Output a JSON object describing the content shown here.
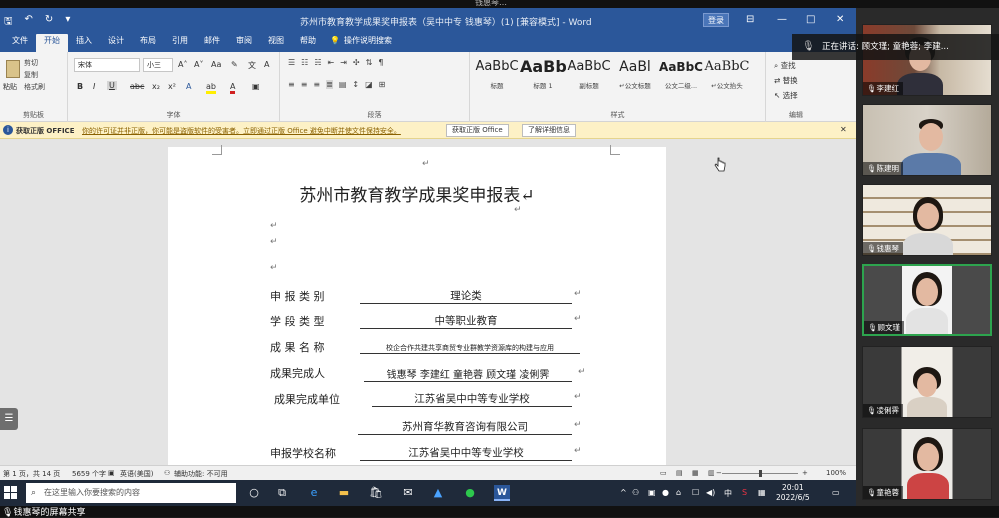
{
  "topbar": {
    "text": "钱惠琴…"
  },
  "window": {
    "title": "苏州市教育教学成果奖申报表（吴中中专 钱惠琴）(1) [兼容模式] - Word",
    "login_label": "登录",
    "controls": [
      "⊟",
      "—",
      "□",
      "✕"
    ]
  },
  "ribbon_tabs": [
    "文件",
    "开始",
    "插入",
    "设计",
    "布局",
    "引用",
    "邮件",
    "审阅",
    "视图",
    "帮助"
  ],
  "ribbon_search": "操作说明搜索",
  "clipboard": {
    "paste": "粘贴",
    "cut": "剪切",
    "copy": "复制",
    "format_painter": "格式刷",
    "label": "剪贴板"
  },
  "font_group": {
    "font_name": "宋体",
    "font_size": "小三",
    "label": "字体",
    "buttons": [
      "B",
      "I",
      "U",
      "abc",
      "x₂",
      "x²"
    ]
  },
  "paragraph_group": {
    "label": "段落"
  },
  "styles_group": {
    "label": "样式",
    "items": [
      {
        "sample": "AaBbC",
        "name": "标题"
      },
      {
        "sample": "AaBb",
        "name": "标题 1"
      },
      {
        "sample": "AaBbC",
        "name": "副标题"
      },
      {
        "sample": "AaBl",
        "name": "↵公文标题"
      },
      {
        "sample": "AaBbC",
        "name": "公文二级..."
      },
      {
        "sample": "AaBbC",
        "name": "↵公文抬头"
      }
    ]
  },
  "editing_group": {
    "find": "查找",
    "replace": "替换",
    "select": "选择",
    "label": "编辑"
  },
  "infobar": {
    "title": "获取正版 OFFICE",
    "message": "你的许可证并非正版，你可能是盗版软件的受害者。立即通过正版 Office 避免中断并使文件保持安全。",
    "btn_genuine": "获取正版 Office",
    "btn_learn": "了解详细信息"
  },
  "document": {
    "title": "苏州市教育教学成果奖申报表↵",
    "rows": [
      {
        "label": "申 报 类 别",
        "value": "理论类"
      },
      {
        "label": "学 段 类 型",
        "value": "中等职业教育"
      },
      {
        "label": "成 果 名 称",
        "value": "校企合作共建共享商贸专业群教学资源库的构建与应用"
      },
      {
        "label": "成果完成人",
        "value": "钱惠琴  李建红  童艳蓉  顾文瑾  凌俐霁"
      },
      {
        "label": "成果完成单位",
        "value": "江苏省吴中中等专业学校"
      },
      {
        "label": "",
        "value": "苏州育华教育咨询有限公司"
      },
      {
        "label": "申报学校名称",
        "value": "江苏省吴中中等专业学校"
      }
    ]
  },
  "status": {
    "page": "第 1 页，共 14 页",
    "words": "5659 个字",
    "lang": "英语(美国)",
    "accessibility": "辅助功能: 不可用",
    "zoom": "100%"
  },
  "taskbar": {
    "search_placeholder": "在这里输入你要搜索的内容",
    "time": "20:01",
    "date": "2022/6/5",
    "tray_lang": "中"
  },
  "share": {
    "text": "钱惠琴的屏幕共享"
  },
  "meeting": {
    "speaking": "正在讲话: 顾文瑾; 童艳蓉; 李建...",
    "participants": [
      "李建红",
      "陈建明",
      "钱惠琴",
      "顾文瑾",
      "凌俐霁",
      "童艳蓉"
    ]
  }
}
